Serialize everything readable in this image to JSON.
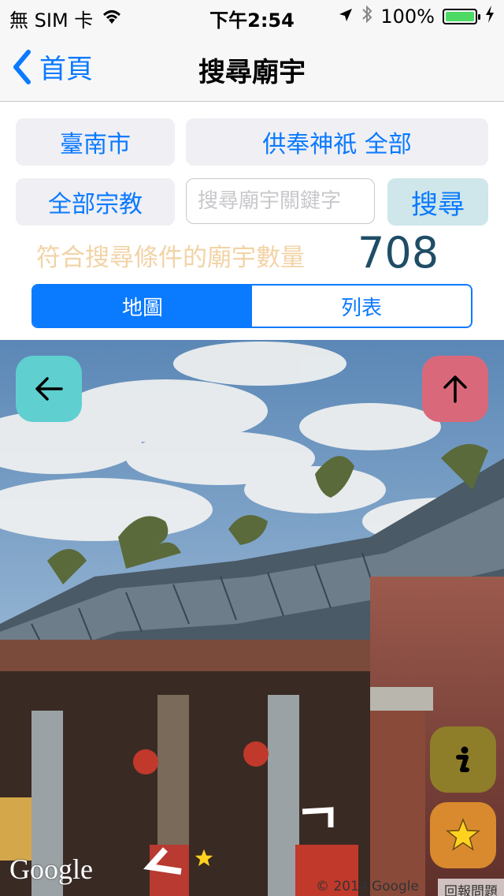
{
  "status_bar": {
    "carrier": "無 SIM 卡",
    "time": "下午2:54",
    "battery": "100%",
    "battery_level": 1.0
  },
  "nav": {
    "back_label": "首頁",
    "title": "搜尋廟宇"
  },
  "filters": {
    "city": "臺南市",
    "deity": "供奉神祇 全部",
    "religion": "全部宗教",
    "search_placeholder": "搜尋廟宇關鍵字",
    "search_button": "搜尋"
  },
  "results": {
    "label": "符合搜尋條件的廟宇數量",
    "count": "708"
  },
  "view_toggle": {
    "map": "地圖",
    "list": "列表",
    "selected": "map"
  },
  "street_view": {
    "back_icon": "arrow-left-icon",
    "compass_icon": "arrow-up-icon",
    "info_icon": "info-icon",
    "favorite_icon": "star-icon",
    "google_logo": "Google",
    "copyright": "© 2014 Google",
    "report": "回報問題"
  },
  "colors": {
    "accent": "#0a7aff",
    "count_label": "#f2d3a6",
    "count_value": "#1f4d66",
    "back_fab": "#5fcfd0",
    "compass_fab": "#d9697a",
    "info_fab": "#8e7e2a",
    "favorite_fab": "#d98a2e"
  }
}
